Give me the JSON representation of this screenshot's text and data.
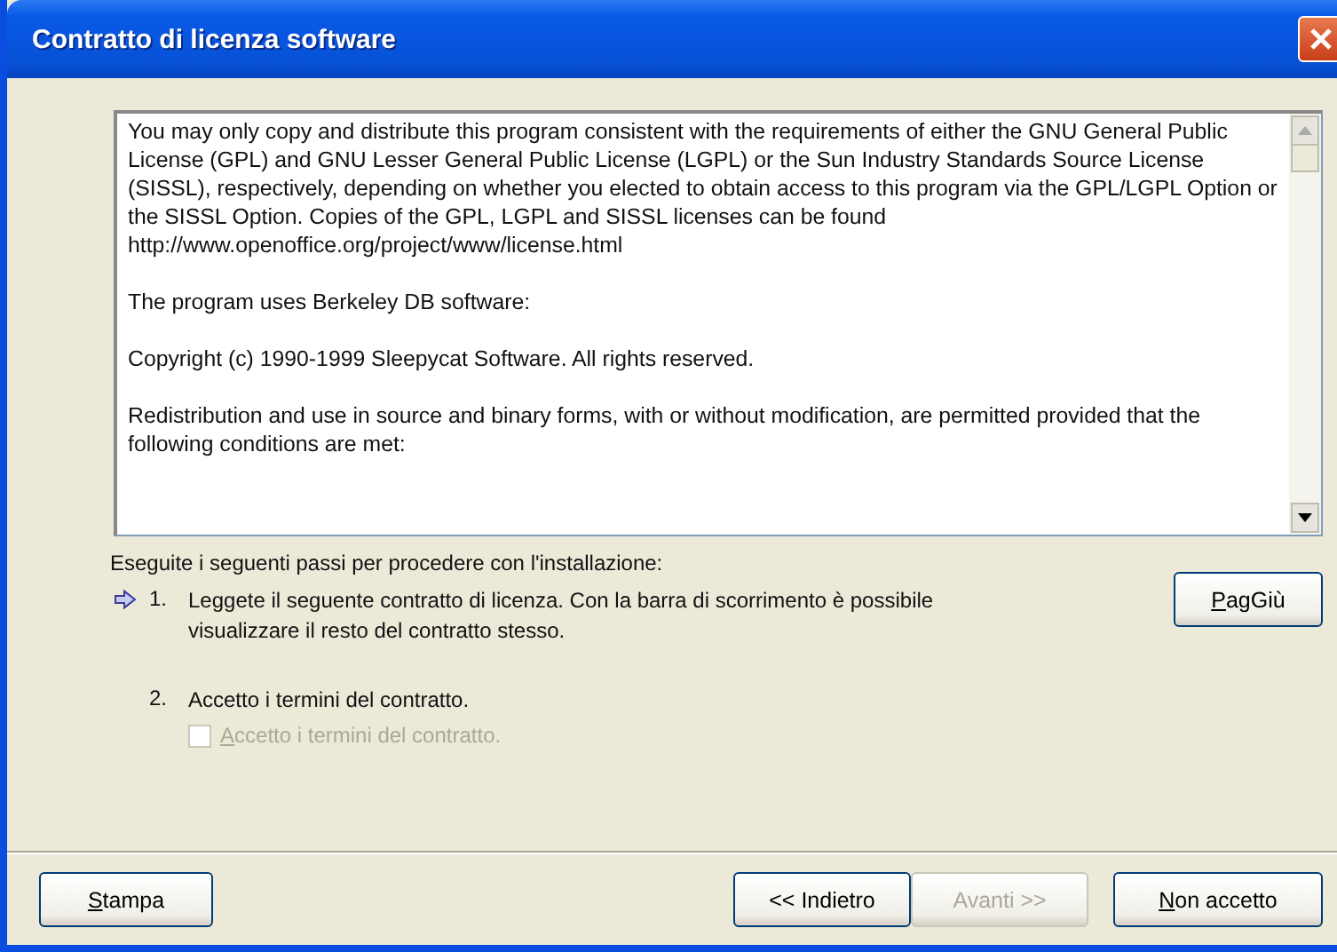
{
  "window": {
    "title": "Contratto di licenza software"
  },
  "license": {
    "paragraphs": [
      "You may only copy and distribute this program consistent with the requirements of either the GNU General Public License (GPL) and GNU Lesser General Public License (LGPL) or the Sun Industry Standards Source License (SISSL), respectively, depending on whether you elected to obtain access to this program via the GPL/LGPL Option or the SISSL Option. Copies of the GPL, LGPL and SISSL licenses can be found http://www.openoffice.org/project/www/license.html",
      "The program uses Berkeley DB software:",
      "Copyright (c) 1990-1999 Sleepycat Software.  All rights reserved.",
      "Redistribution and use in source and binary forms, with or without modification, are permitted provided that the following conditions are met:"
    ]
  },
  "intro": "Eseguite i seguenti passi per procedere con l'installazione:",
  "steps": [
    {
      "number": "1.",
      "text": "Leggete il seguente contratto di licenza. Con la barra di scorrimento è possibile visualizzare il resto del contratto stesso.",
      "current": true
    },
    {
      "number": "2.",
      "text": "Accetto i termini del contratto.",
      "current": false
    }
  ],
  "page_down_button": {
    "label": "PagGiù"
  },
  "accept_checkbox": {
    "label": "Accetto i termini del contratto.",
    "checked": false,
    "disabled": true
  },
  "left_buttons": [
    {
      "label": "Stampa",
      "disabled": false
    }
  ],
  "right_buttons": [
    {
      "label": "<< Indietro",
      "disabled": false
    },
    {
      "label": "Avanti >>",
      "disabled": true
    },
    {
      "label": "Non accetto",
      "disabled": false
    }
  ]
}
